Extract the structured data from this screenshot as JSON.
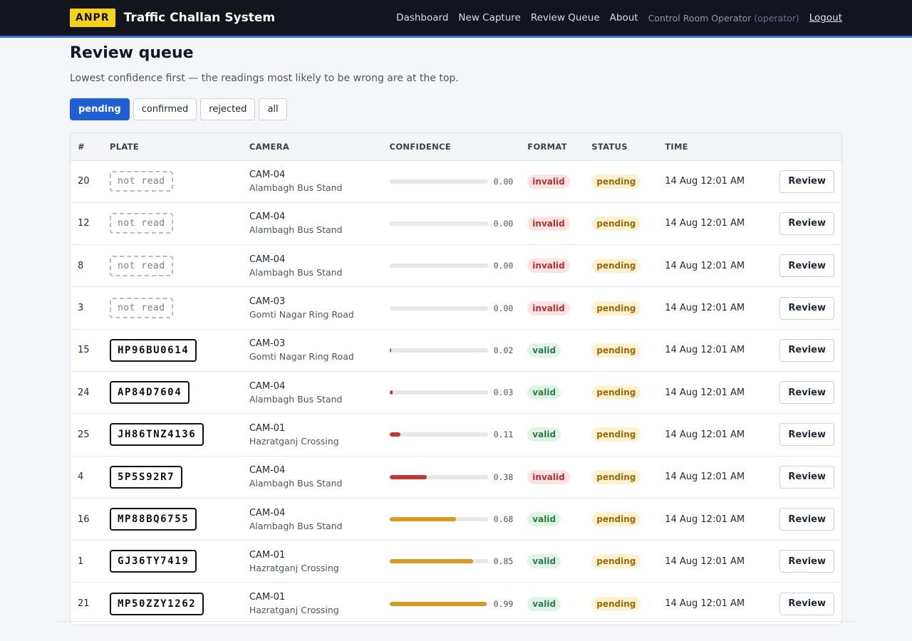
{
  "header": {
    "logo": "ANPR",
    "title": "Traffic Challan System",
    "nav": [
      "Dashboard",
      "New Capture",
      "Review Queue",
      "About"
    ],
    "user_name": "Control Room Operator",
    "user_role": "(operator)",
    "logout": "Logout"
  },
  "page": {
    "title": "Review queue",
    "subtitle": "Lowest confidence first — the readings most likely to be wrong are at the top."
  },
  "filters": [
    "pending",
    "confirmed",
    "rejected",
    "all"
  ],
  "active_filter": "pending",
  "colors": {
    "accent": "#1f5fd3",
    "low_conf": "#c6362f",
    "mid_conf": "#d99a1e"
  },
  "table": {
    "columns": [
      "#",
      "PLATE",
      "CAMERA",
      "CONFIDENCE",
      "FORMAT",
      "STATUS",
      "TIME",
      ""
    ],
    "rows": [
      {
        "id": "20",
        "plate": "not read",
        "read": false,
        "camera": "CAM-04",
        "location": "Alambagh Bus Stand",
        "confidence": "0.00",
        "format": "invalid",
        "status": "pending",
        "time": "14 Aug 12:01 AM",
        "action": "Review"
      },
      {
        "id": "12",
        "plate": "not read",
        "read": false,
        "camera": "CAM-04",
        "location": "Alambagh Bus Stand",
        "confidence": "0.00",
        "format": "invalid",
        "status": "pending",
        "time": "14 Aug 12:01 AM",
        "action": "Review"
      },
      {
        "id": "8",
        "plate": "not read",
        "read": false,
        "camera": "CAM-04",
        "location": "Alambagh Bus Stand",
        "confidence": "0.00",
        "format": "invalid",
        "status": "pending",
        "time": "14 Aug 12:01 AM",
        "action": "Review"
      },
      {
        "id": "3",
        "plate": "not read",
        "read": false,
        "camera": "CAM-03",
        "location": "Gomti Nagar Ring Road",
        "confidence": "0.00",
        "format": "invalid",
        "status": "pending",
        "time": "14 Aug 12:01 AM",
        "action": "Review"
      },
      {
        "id": "15",
        "plate": "HP96BU0614",
        "read": true,
        "camera": "CAM-03",
        "location": "Gomti Nagar Ring Road",
        "confidence": "0.02",
        "format": "valid",
        "status": "pending",
        "time": "14 Aug 12:01 AM",
        "action": "Review"
      },
      {
        "id": "24",
        "plate": "AP84D7604",
        "read": true,
        "camera": "CAM-04",
        "location": "Alambagh Bus Stand",
        "confidence": "0.03",
        "format": "valid",
        "status": "pending",
        "time": "14 Aug 12:01 AM",
        "action": "Review"
      },
      {
        "id": "25",
        "plate": "JH86TNZ4136",
        "read": true,
        "camera": "CAM-01",
        "location": "Hazratganj Crossing",
        "confidence": "0.11",
        "format": "valid",
        "status": "pending",
        "time": "14 Aug 12:01 AM",
        "action": "Review"
      },
      {
        "id": "4",
        "plate": "5P5S92R7",
        "read": true,
        "camera": "CAM-04",
        "location": "Alambagh Bus Stand",
        "confidence": "0.38",
        "format": "invalid",
        "status": "pending",
        "time": "14 Aug 12:01 AM",
        "action": "Review"
      },
      {
        "id": "16",
        "plate": "MP88BQ6755",
        "read": true,
        "camera": "CAM-04",
        "location": "Alambagh Bus Stand",
        "confidence": "0.68",
        "format": "valid",
        "status": "pending",
        "time": "14 Aug 12:01 AM",
        "action": "Review"
      },
      {
        "id": "1",
        "plate": "GJ36TY7419",
        "read": true,
        "camera": "CAM-01",
        "location": "Hazratganj Crossing",
        "confidence": "0.85",
        "format": "valid",
        "status": "pending",
        "time": "14 Aug 12:01 AM",
        "action": "Review"
      },
      {
        "id": "21",
        "plate": "MP50ZZY1262",
        "read": true,
        "camera": "CAM-01",
        "location": "Hazratganj Crossing",
        "confidence": "0.99",
        "format": "valid",
        "status": "pending",
        "time": "14 Aug 12:01 AM",
        "action": "Review"
      }
    ]
  }
}
